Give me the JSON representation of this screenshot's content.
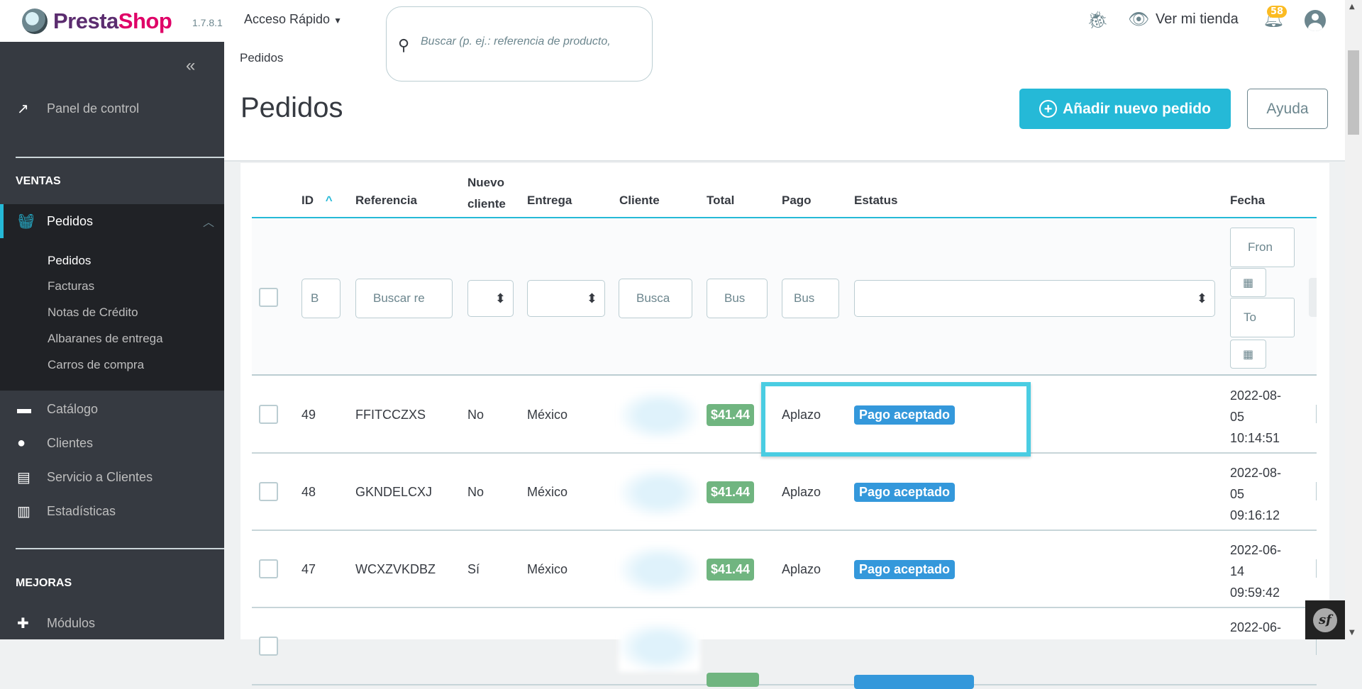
{
  "topbar": {
    "logo_text": "PrestaShop",
    "version": "1.7.8.1",
    "quick_access": "Acceso Rápido",
    "search_placeholder": "Buscar (p. ej.: referencia de producto,",
    "view_store": "Ver mi tienda",
    "notifications_count": "58"
  },
  "header": {
    "breadcrumb": "Pedidos",
    "title": "Pedidos",
    "add_button": "Añadir nuevo pedido",
    "help_button": "Ayuda"
  },
  "sidebar": {
    "collapse": "«",
    "dashboard": "Panel de control",
    "section_sales": "VENTAS",
    "orders": "Pedidos",
    "orders_sub": [
      "Pedidos",
      "Facturas",
      "Notas de Crédito",
      "Albaranes de entrega",
      "Carros de compra"
    ],
    "items": [
      "Catálogo",
      "Clientes",
      "Servicio a Clientes",
      "Estadísticas"
    ],
    "section_improve": "MEJORAS",
    "modules": "Módulos"
  },
  "table": {
    "headers": {
      "id": "ID",
      "reference": "Referencia",
      "new_client_1": "Nuevo",
      "new_client_2": "cliente",
      "delivery": "Entrega",
      "customer": "Cliente",
      "total": "Total",
      "payment": "Pago",
      "status": "Estatus",
      "date": "Fecha"
    },
    "filters": {
      "id": "B",
      "reference": "Buscar re",
      "customer": "Busca",
      "total": "Bus",
      "payment": "Bus",
      "date_from": "Fron",
      "date_to": "To"
    },
    "rows": [
      {
        "id": "49",
        "reference": "FFITCCZXS",
        "new_client": "No",
        "delivery": "México",
        "total": "$41.44",
        "payment": "Aplazo",
        "status": "Pago aceptado",
        "date": [
          "2022-08-",
          "05",
          "10:14:51"
        ]
      },
      {
        "id": "48",
        "reference": "GKNDELCXJ",
        "new_client": "No",
        "delivery": "México",
        "total": "$41.44",
        "payment": "Aplazo",
        "status": "Pago aceptado",
        "date": [
          "2022-08-",
          "05",
          "09:16:12"
        ]
      },
      {
        "id": "47",
        "reference": "WCXZVKDBZ",
        "new_client": "Sí",
        "delivery": "México",
        "total": "$41.44",
        "payment": "Aplazo",
        "status": "Pago aceptado",
        "date": [
          "2022-06-",
          "14",
          "09:59:42"
        ]
      },
      {
        "id": "",
        "reference": "",
        "new_client": "",
        "delivery": "",
        "total": "",
        "payment": "",
        "status": "",
        "date": [
          "2022-06-"
        ]
      }
    ]
  },
  "colors": {
    "accent": "#25b9d7",
    "total_badge": "#70b580",
    "status_badge": "#3498db",
    "highlight": "#4acde2",
    "sidebar": "#363a41"
  }
}
